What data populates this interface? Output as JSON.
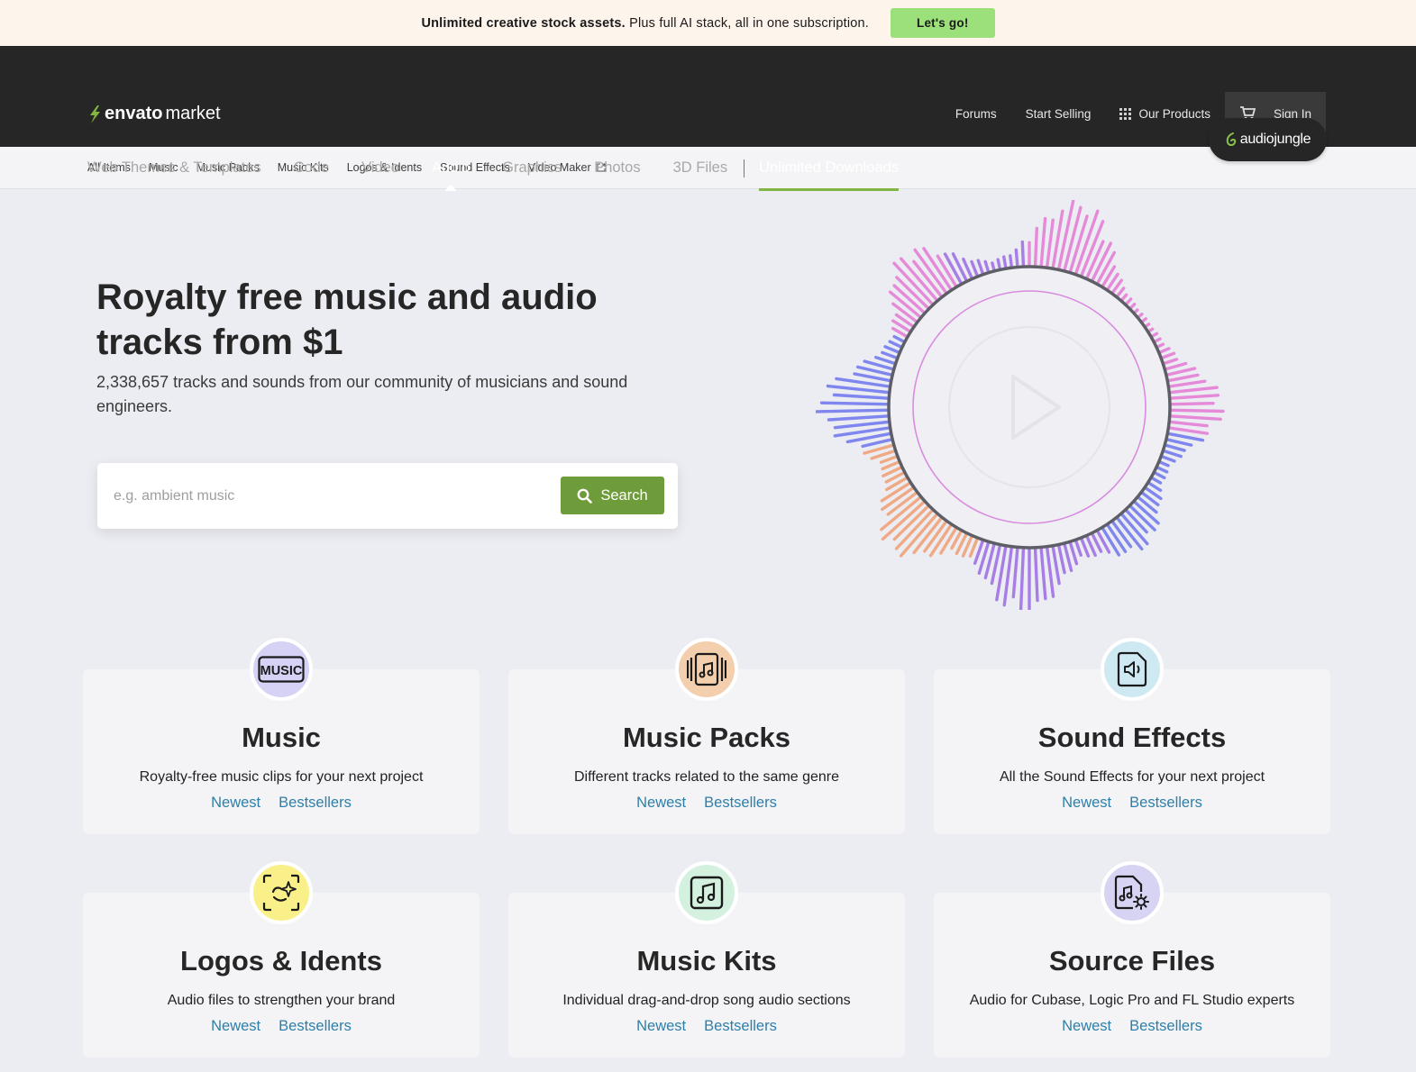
{
  "promo": {
    "bold_text": "Unlimited creative stock assets.",
    "text": " Plus full AI stack, all in one subscription.",
    "cta": "Let's go!"
  },
  "header": {
    "brand_word1": "envato",
    "brand_word2": "market",
    "forums": "Forums",
    "start_selling": "Start Selling",
    "our_products": "Our Products",
    "sign_in": "Sign In",
    "accent_color": "#82b541"
  },
  "nav": {
    "items": [
      "Web Themes & Templates",
      "Code",
      "Video",
      "Audio",
      "Graphics",
      "Photos",
      "3D Files"
    ],
    "active": "Audio",
    "unlimited": "Unlimited Downloads"
  },
  "badge": {
    "label": "audiojungle"
  },
  "subnav": {
    "items": [
      "All Items",
      "Music",
      "Music Packs",
      "Music Kits",
      "Logos & Idents",
      "Sound Effects"
    ],
    "video_maker": "Video Maker"
  },
  "hero": {
    "title": "Royalty free music and audio tracks from $1",
    "subtitle": "2,338,657 tracks and sounds from our community of musicians and sound engineers.",
    "search_placeholder": "e.g. ambient music",
    "search_button": "Search"
  },
  "cards": [
    {
      "title": "Music",
      "desc": "Royalty-free music clips for your next project",
      "newest": "Newest",
      "bestsellers": "Bestsellers",
      "icon": "music-text-icon",
      "color": "#d6d2f5"
    },
    {
      "title": "Music Packs",
      "desc": "Different tracks related to the same genre",
      "newest": "Newest",
      "bestsellers": "Bestsellers",
      "icon": "music-pack-icon",
      "color": "#f4cfae"
    },
    {
      "title": "Sound Effects",
      "desc": "All the Sound Effects for your next project",
      "newest": "Newest",
      "bestsellers": "Bestsellers",
      "icon": "speaker-file-icon",
      "color": "#cfe9f2"
    },
    {
      "title": "Logos & Idents",
      "desc": "Audio files to strengthen your brand",
      "newest": "Newest",
      "bestsellers": "Bestsellers",
      "icon": "sparkle-face-icon",
      "color": "#faf08a"
    },
    {
      "title": "Music Kits",
      "desc": "Individual drag-and-drop song audio sections",
      "newest": "Newest",
      "bestsellers": "Bestsellers",
      "icon": "music-note-box-icon",
      "color": "#d3f1de"
    },
    {
      "title": "Source Files",
      "desc": "Audio for Cubase, Logic Pro and FL Studio experts",
      "newest": "Newest",
      "bestsellers": "Bestsellers",
      "icon": "file-gear-icon",
      "color": "#d7d3f3"
    }
  ],
  "colors": {
    "search_button": "#6e9c3a",
    "link": "#2e7fa8",
    "promo_button": "#9ce07b"
  }
}
